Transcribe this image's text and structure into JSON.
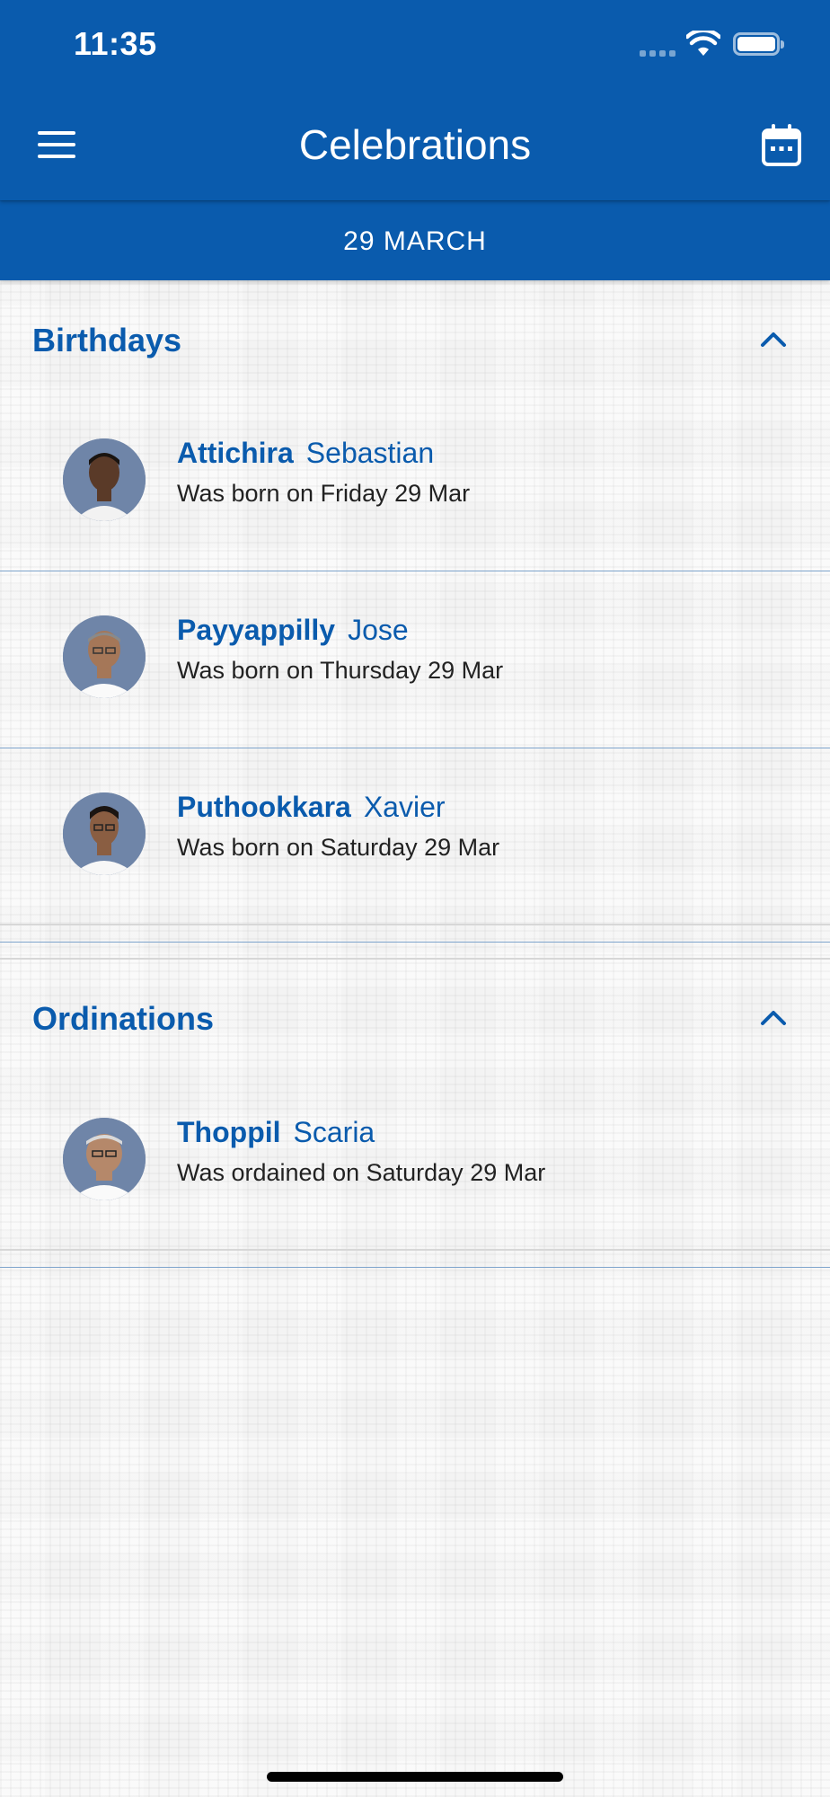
{
  "status_bar": {
    "time": "11:35"
  },
  "header": {
    "title": "Celebrations",
    "menu_icon": "hamburger-menu-icon",
    "calendar_icon": "calendar-icon"
  },
  "date_bar": {
    "label": "29 MARCH"
  },
  "sections": {
    "birthdays": {
      "title": "Birthdays",
      "items": [
        {
          "surname": "Attichira",
          "given": "Sebastian",
          "detail": "Was born on Friday 29 Mar"
        },
        {
          "surname": "Payyappilly",
          "given": "Jose",
          "detail": "Was born on Thursday 29 Mar"
        },
        {
          "surname": "Puthookkara",
          "given": "Xavier",
          "detail": "Was born on Saturday 29 Mar"
        }
      ]
    },
    "ordinations": {
      "title": "Ordinations",
      "items": [
        {
          "surname": "Thoppil",
          "given": "Scaria",
          "detail": "Was ordained on Saturday 29 Mar"
        }
      ]
    }
  },
  "colors": {
    "primary": "#0a5bad",
    "divider": "#7ea4cc",
    "text_dark": "#222222"
  }
}
